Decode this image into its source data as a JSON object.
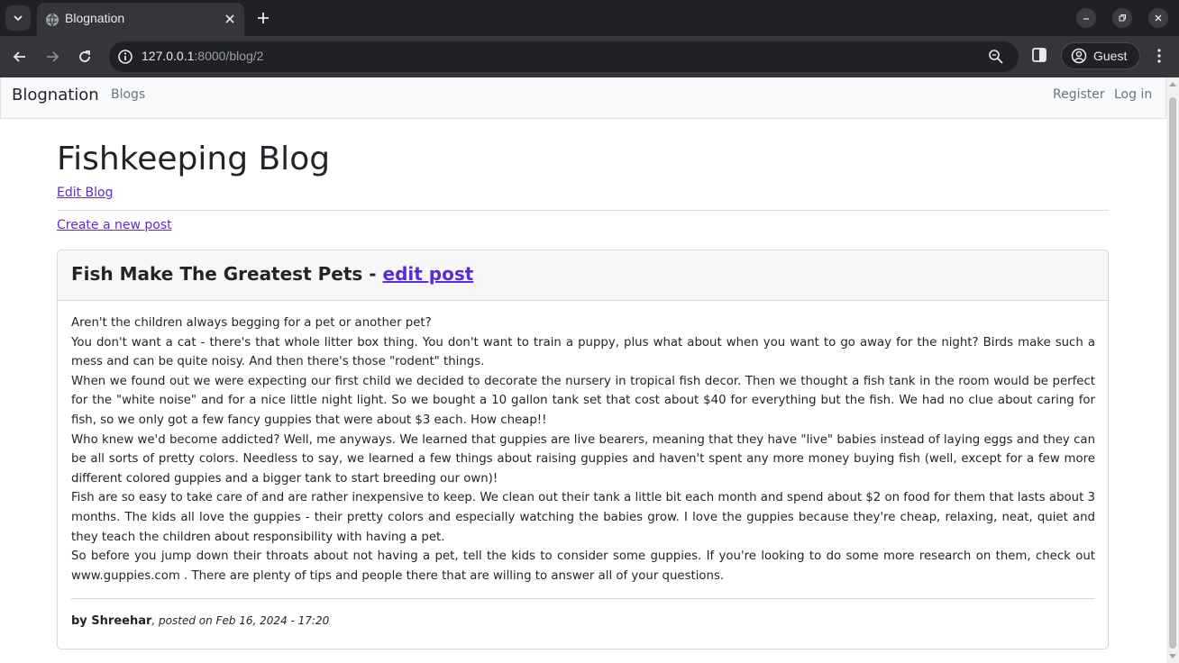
{
  "browser": {
    "tab_title": "Blognation",
    "url_host": "127.0.0.1",
    "url_rest": ":8000/blog/2",
    "profile_name": "Guest"
  },
  "site_nav": {
    "brand": "Blognation",
    "blogs_link": "Blogs",
    "register_link": "Register",
    "login_link": "Log in"
  },
  "page": {
    "title": "Fishkeeping Blog",
    "edit_blog_link": "Edit Blog",
    "create_post_link": "Create a new post"
  },
  "post": {
    "title": "Fish Make The Greatest Pets - ",
    "edit_link": "edit post",
    "paragraphs": [
      "Aren't the children always begging for a pet or another pet?",
      "You don't want a cat - there's that whole litter box thing. You don't want to train a puppy, plus what about when you want to go away for the night? Birds make such a mess and can be quite noisy. And then there's those \"rodent\" things.",
      "When we found out we were expecting our first child we decided to decorate the nursery in tropical fish decor. Then we thought a fish tank in the room would be perfect for the \"white noise\" and for a nice little night light. So we bought a 10 gallon tank set that cost about $40 for everything but the fish. We had no clue about caring for fish, so we only got a few fancy guppies that were about $3 each. How cheap!!",
      "Who knew we'd become addicted? Well, me anyways. We learned that guppies are live bearers, meaning that they have \"live\" babies instead of laying eggs and they can be all sorts of pretty colors. Needless to say, we learned a few things about raising guppies and haven't spent any more money buying fish (well, except for a few more different colored guppies and a bigger tank to start breeding our own)!",
      "Fish are so easy to take care of and are rather inexpensive to keep. We clean out their tank a little bit each month and spend about $2 on food for them that lasts about 3 months. The kids all love the guppies - their pretty colors and especially watching the babies grow. I love the guppies because they're cheap, relaxing, neat, quiet and they teach the children about responsibility with having a pet.",
      "So before you jump down their throats about not having a pet, tell the kids to consider some guppies. If you're looking to do some more research on them, check out www.guppies.com . There are plenty of tips and people there that are willing to answer all of your questions."
    ],
    "author": "by Shreehar",
    "posted_on": ", posted on Feb 16, 2024 - 17:20"
  },
  "colors": {
    "link": "#5a2bd6",
    "chrome_dark": "#202124",
    "chrome_toolbar": "#35363a"
  },
  "icons": [
    "tab-search-icon",
    "favicon-icon",
    "close-icon",
    "plus-icon",
    "minimize-icon",
    "restore-icon",
    "window-close-icon",
    "back-icon",
    "forward-icon",
    "reload-icon",
    "info-icon",
    "zoom-icon",
    "side-panel-icon",
    "profile-icon",
    "kebab-menu-icon"
  ]
}
